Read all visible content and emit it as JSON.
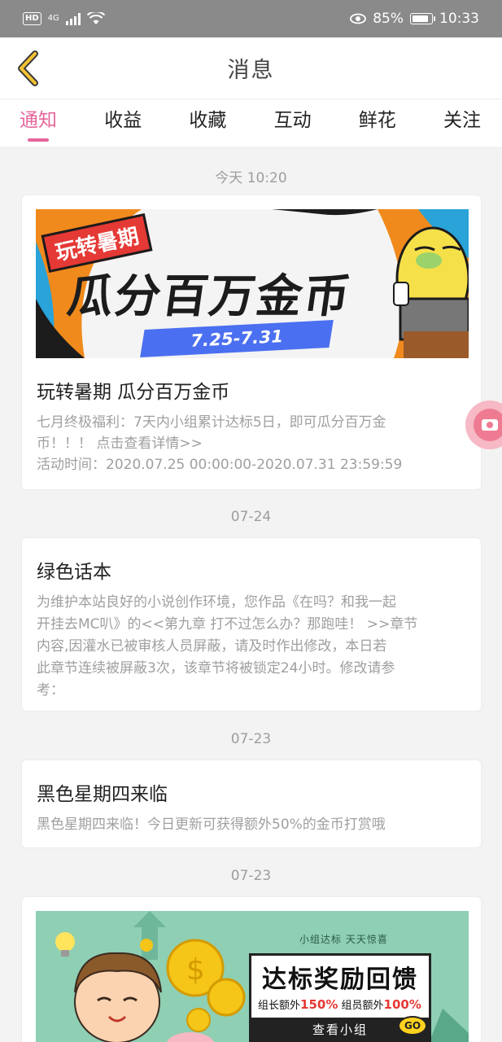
{
  "status_bar": {
    "hd": "HD",
    "network": "4G",
    "battery_percent": "85%",
    "battery_level": 0.85,
    "time": "10:33"
  },
  "header": {
    "title": "消息",
    "back_icon": "chevron-left-icon"
  },
  "tabs": [
    {
      "label": "通知",
      "active": true
    },
    {
      "label": "收益",
      "active": false
    },
    {
      "label": "收藏",
      "active": false
    },
    {
      "label": "互动",
      "active": false
    },
    {
      "label": "鲜花",
      "active": false
    },
    {
      "label": "关注",
      "active": false
    }
  ],
  "messages": [
    {
      "timestamp": "今天 10:20",
      "banner": {
        "tag": "玩转暑期",
        "headline": "瓜分百万金币",
        "dates": "7.25-7.31"
      },
      "title": "玩转暑期 瓜分百万金币",
      "body_line1": "七月终极福利：7天内小组累计达标5日，即可瓜分百万金",
      "body_line2": "币！！！ 点击查看详情>>",
      "body_line3": "活动时间：2020.07.25 00:00:00-2020.07.31 23:59:59"
    },
    {
      "timestamp": "07-24",
      "title": "绿色话本",
      "body_line1": "为维护本站良好的小说创作环境，您作品《在吗？和我一起",
      "body_line2": "开挂去MC叭》的<<第九章 打不过怎么办？那跑哇！ >>章节",
      "body_line3": "内容,因灌水已被审核人员屏蔽，请及时作出修改，本日若",
      "body_line4": "此章节连续被屏蔽3次，该章节将被锁定24小时。修改请参",
      "body_line5": "考："
    },
    {
      "timestamp": "07-23",
      "title": "黑色星期四来临",
      "body_line1": "黑色星期四来临！今日更新可获得额外50%的金币打赏哦"
    },
    {
      "timestamp": "07-23",
      "banner": {
        "slogan": "小组达标 天天惊喜",
        "headline": "达标奖励回馈",
        "leader_text": "组长额外",
        "leader_pct": "150%",
        "member_text": "组员额外",
        "member_pct": "100%",
        "button": "查看小组",
        "go": "GO"
      }
    }
  ],
  "colors": {
    "accent": "#e5669a",
    "status_bar": "#8a8a8a",
    "banner_orange": "#f08a1c",
    "banner_blue": "#4a6ff0",
    "banner_red": "#e53935"
  },
  "floating_button_icon": "screen-record-icon"
}
